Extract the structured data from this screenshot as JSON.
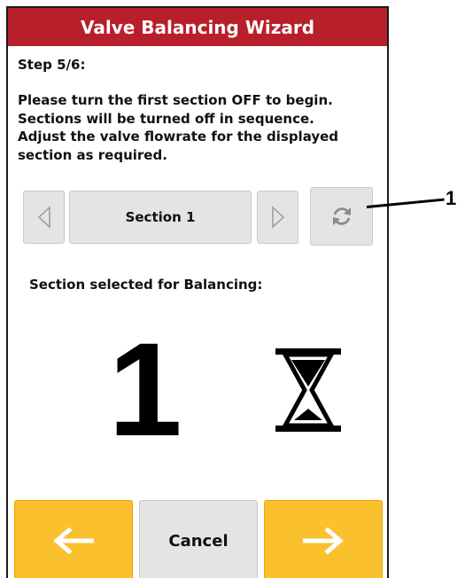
{
  "title": "Valve Balancing Wizard",
  "step": "Step 5/6:",
  "instructions": [
    "Please turn the first section OFF to begin.",
    "Sections will be turned off in sequence.",
    "Adjust the valve flowrate for the displayed",
    "section as required."
  ],
  "section_selector": {
    "prev_icon": "triangle-left-icon",
    "value": "Section 1",
    "next_icon": "triangle-right-icon",
    "refresh_icon": "refresh-icon"
  },
  "selected_label": "Section selected for Balancing:",
  "selected_number": "1",
  "status_icon": "hourglass-icon",
  "buttons": {
    "back_icon": "arrow-left-icon",
    "cancel_label": "Cancel",
    "forward_icon": "arrow-right-icon"
  },
  "callout": "1",
  "colors": {
    "title_bar": "#b81f2a",
    "accent_yellow": "#fbc02d",
    "button_gray": "#e4e4e4"
  }
}
